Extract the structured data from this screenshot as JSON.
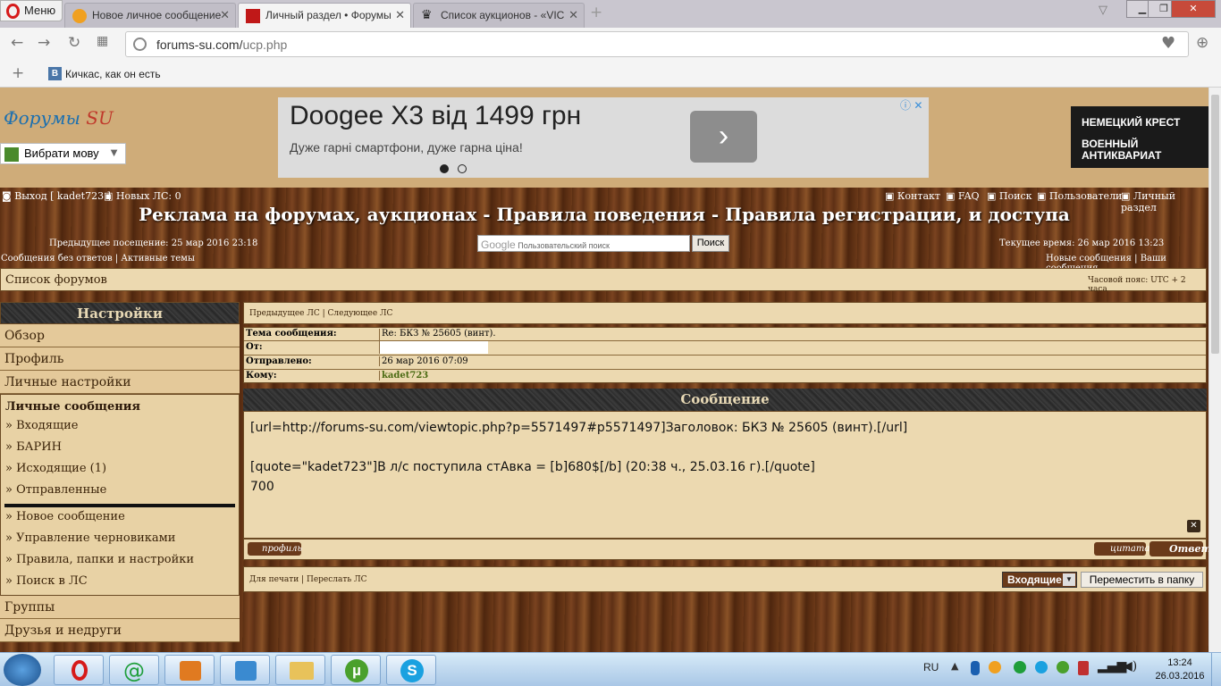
{
  "browser": {
    "menu_label": "Меню",
    "tabs": [
      {
        "title": "Новое личное сообщение",
        "active": false
      },
      {
        "title": "Личный раздел • Форумы",
        "active": true
      },
      {
        "title": "Список аукционов - «VIC",
        "active": false
      }
    ],
    "url_host": "forums-su.com/",
    "url_path": "ucp.php",
    "bookmark": "Кичкас, как он есть"
  },
  "header": {
    "logo_text": "Форумы",
    "logo_su": "SU",
    "translate_label": "Вибрати мову",
    "ad": {
      "title": "Doogee X3 від 1499 грн",
      "subtitle": "Дуже гарні смартфони, дуже гарна ціна!"
    },
    "side_ad": [
      "НЕМЕЦКИЙ КРЕСТ",
      "ВОЕННЫЙ",
      "АНТИКВАРИАТ"
    ]
  },
  "topbar": {
    "logout": "Выход [ kadet723 ]",
    "new_pm": "Новых ЛС: 0",
    "links": [
      "Контакт",
      "FAQ",
      "Поиск",
      "Пользователи",
      "Личный раздел"
    ],
    "site_title": "Реклама на форумах, аукционах - Правила поведения - Правила регистрации, и доступа",
    "last_visit": "Предыдущее посещение: 25 мар 2016 23:18",
    "current_time": "Текущее время: 26 мар 2016 13:23",
    "search_placeholder": "Пользовательский поиск",
    "search_button": "Поиск",
    "google": "Google",
    "left_links": [
      "Сообщения без ответов",
      "Активные темы"
    ],
    "right_links": [
      "Новые сообщения",
      "Ваши сообщения"
    ]
  },
  "breadcrumb": {
    "forums": "Список форумов",
    "timezone": "Часовой пояс: UTC + 2 часа"
  },
  "sidebar": {
    "heading": "Настройки",
    "items": [
      "Обзор",
      "Профиль",
      "Личные настройки"
    ],
    "pm_heading": "Личные сообщения",
    "pm_folders": [
      "» Входящие",
      "» БАРИН",
      "» Исходящие (1)",
      "» Отправленные"
    ],
    "pm_actions": [
      "» Новое сообщение",
      "» Управление черновиками",
      "» Правила, папки и настройки",
      "» Поиск в ЛС"
    ],
    "groups": "Группы",
    "friends": "Друзья и недруги"
  },
  "message": {
    "prev": "Предыдущее ЛС",
    "next": "Следующее ЛС",
    "fields": [
      {
        "label": "Тема сообщения:",
        "value": "Re: БКЗ № 25605 (винт)."
      },
      {
        "label": "От:",
        "value": ""
      },
      {
        "label": "Отправлено:",
        "value": "26 мар 2016 07:09"
      },
      {
        "label": "Кому:",
        "value": "kadet723"
      }
    ],
    "heading": "Сообщение",
    "body_line1": "[url=http://forums-su.com/viewtopic.php?p=5571497#p5571497]Заголовок: БКЗ № 25605 (винт).[/url]",
    "body_line2": "[quote=\"kadet723\"]В л/с поступила стАвка = [b]680$[/b] (20:38 ч., 25.03.16 г).[/quote]",
    "body_line3": "700",
    "profile_btn": "профиль",
    "quote_btn": "цитата",
    "reply_btn": "Ответ",
    "print": "Для печати",
    "forward": "Переслать ЛС",
    "folder_select": "Входящие",
    "move_button": "Переместить в папку"
  },
  "taskbar": {
    "lang": "RU",
    "time": "13:24",
    "date": "26.03.2016"
  },
  "colors": {
    "wood": "#6b3918",
    "panel": "#ecd9b0",
    "accent_green": "#4a6a12"
  }
}
